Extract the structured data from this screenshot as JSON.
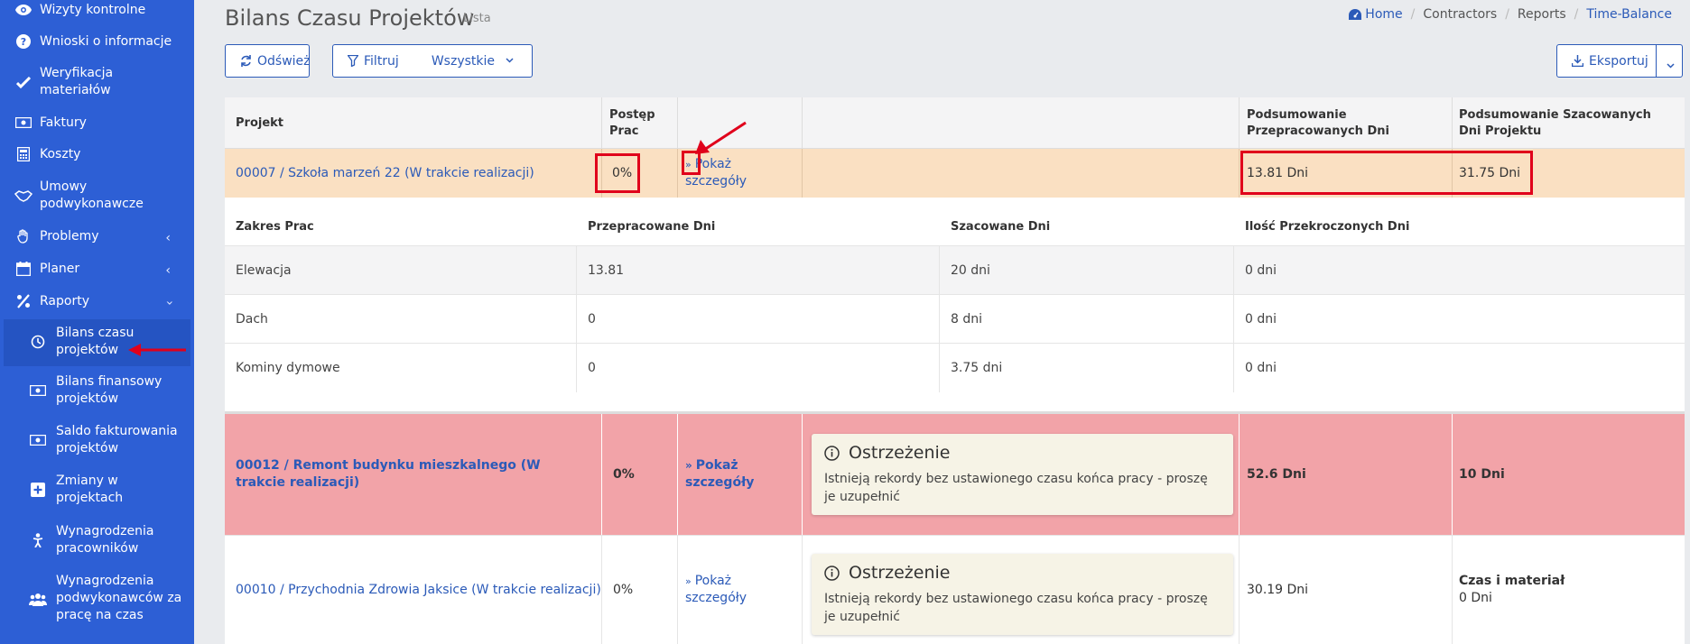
{
  "sidebar": {
    "items": [
      {
        "label": "Wizyty kontrolne",
        "icon": "eye-icon"
      },
      {
        "label": "Wnioski o informacje",
        "icon": "question-circle-icon"
      },
      {
        "label": "Weryfikacja materiałów",
        "icon": "check-icon"
      },
      {
        "label": "Faktury",
        "icon": "money-bill-icon"
      },
      {
        "label": "Koszty",
        "icon": "calculator-icon"
      },
      {
        "label": "Umowy podwykonawcze",
        "icon": "handshake-icon"
      },
      {
        "label": "Problemy",
        "icon": "hand-icon"
      },
      {
        "label": "Planer",
        "icon": "calendar-icon"
      },
      {
        "label": "Raporty",
        "icon": "percent-icon"
      }
    ],
    "subitems": [
      {
        "label": "Bilans czasu projektów",
        "icon": "clock-icon"
      },
      {
        "label": "Bilans finansowy projektów",
        "icon": "money-bill-icon"
      },
      {
        "label": "Saldo fakturowania projektów",
        "icon": "money-bill-icon"
      },
      {
        "label": "Zmiany w projektach",
        "icon": "plus-square-icon"
      },
      {
        "label": "Wynagrodzenia pracowników",
        "icon": "person-icon"
      },
      {
        "label": "Wynagrodzenia podwykonawców za pracę na czas",
        "icon": "users-icon"
      }
    ]
  },
  "header": {
    "title": "Bilans Czasu Projektów",
    "subtitle": "Lista",
    "breadcrumb": [
      "Home",
      "Contractors",
      "Reports",
      "Time-Balance"
    ]
  },
  "toolbar": {
    "refresh_label": "Odśwież",
    "filter_label": "Filtruj",
    "filter_value": "Wszystkie",
    "export_label": "Eksportuj"
  },
  "table": {
    "headers": [
      "Projekt",
      "Postęp Prac",
      "",
      "",
      "Podsumowanie Przepracowanych Dni",
      "Podsumowanie Szacowanych Dni Projektu"
    ],
    "rows": [
      {
        "project": "00007 / Szkoła marzeń 22 (W trakcie realizacji)",
        "progress": "0%",
        "details_label": "Pokaż szczegóły",
        "worked": "13.81 Dni",
        "estimated": "31.75 Dni"
      },
      {
        "project": "00012 / Remont budynku mieszkalnego (W trakcie realizacji)",
        "progress": "0%",
        "details_label": "Pokaż szczegóły",
        "warning_title": "Ostrzeżenie",
        "warning_text": "Istnieją rekordy bez ustawionego czasu końca pracy - proszę je uzupełnić",
        "worked": "52.6 Dni",
        "estimated": "10 Dni"
      },
      {
        "project": "00010 / Przychodnia Zdrowia Jaksice (W trakcie realizacji)",
        "progress": "0%",
        "details_label": "Pokaż szczegóły",
        "warning_title": "Ostrzeżenie",
        "warning_text": "Istnieją rekordy bez ustawionego czasu końca pracy - proszę je uzupełnić",
        "worked": "30.19 Dni",
        "estimated_title": "Czas i materiał",
        "estimated": "0 Dni"
      }
    ],
    "details": {
      "headers": [
        "Zakres Prac",
        "Przepracowane  Dni",
        "Szacowane  Dni",
        "Ilość Przekroczonych  Dni"
      ],
      "rows": [
        [
          "Elewacja",
          "13.81",
          "20 dni",
          "0 dni"
        ],
        [
          "Dach",
          "0",
          "8 dni",
          "0 dni"
        ],
        [
          "Kominy dymowe",
          "0",
          "3.75 dni",
          "0 dni"
        ]
      ]
    }
  },
  "colors": {
    "sidebar": "#2d5fd5",
    "accent": "#2b5ab8",
    "row_highlight": "#fae0c2",
    "row_danger": "#f2a3a8",
    "annotation": "#e0001b"
  }
}
